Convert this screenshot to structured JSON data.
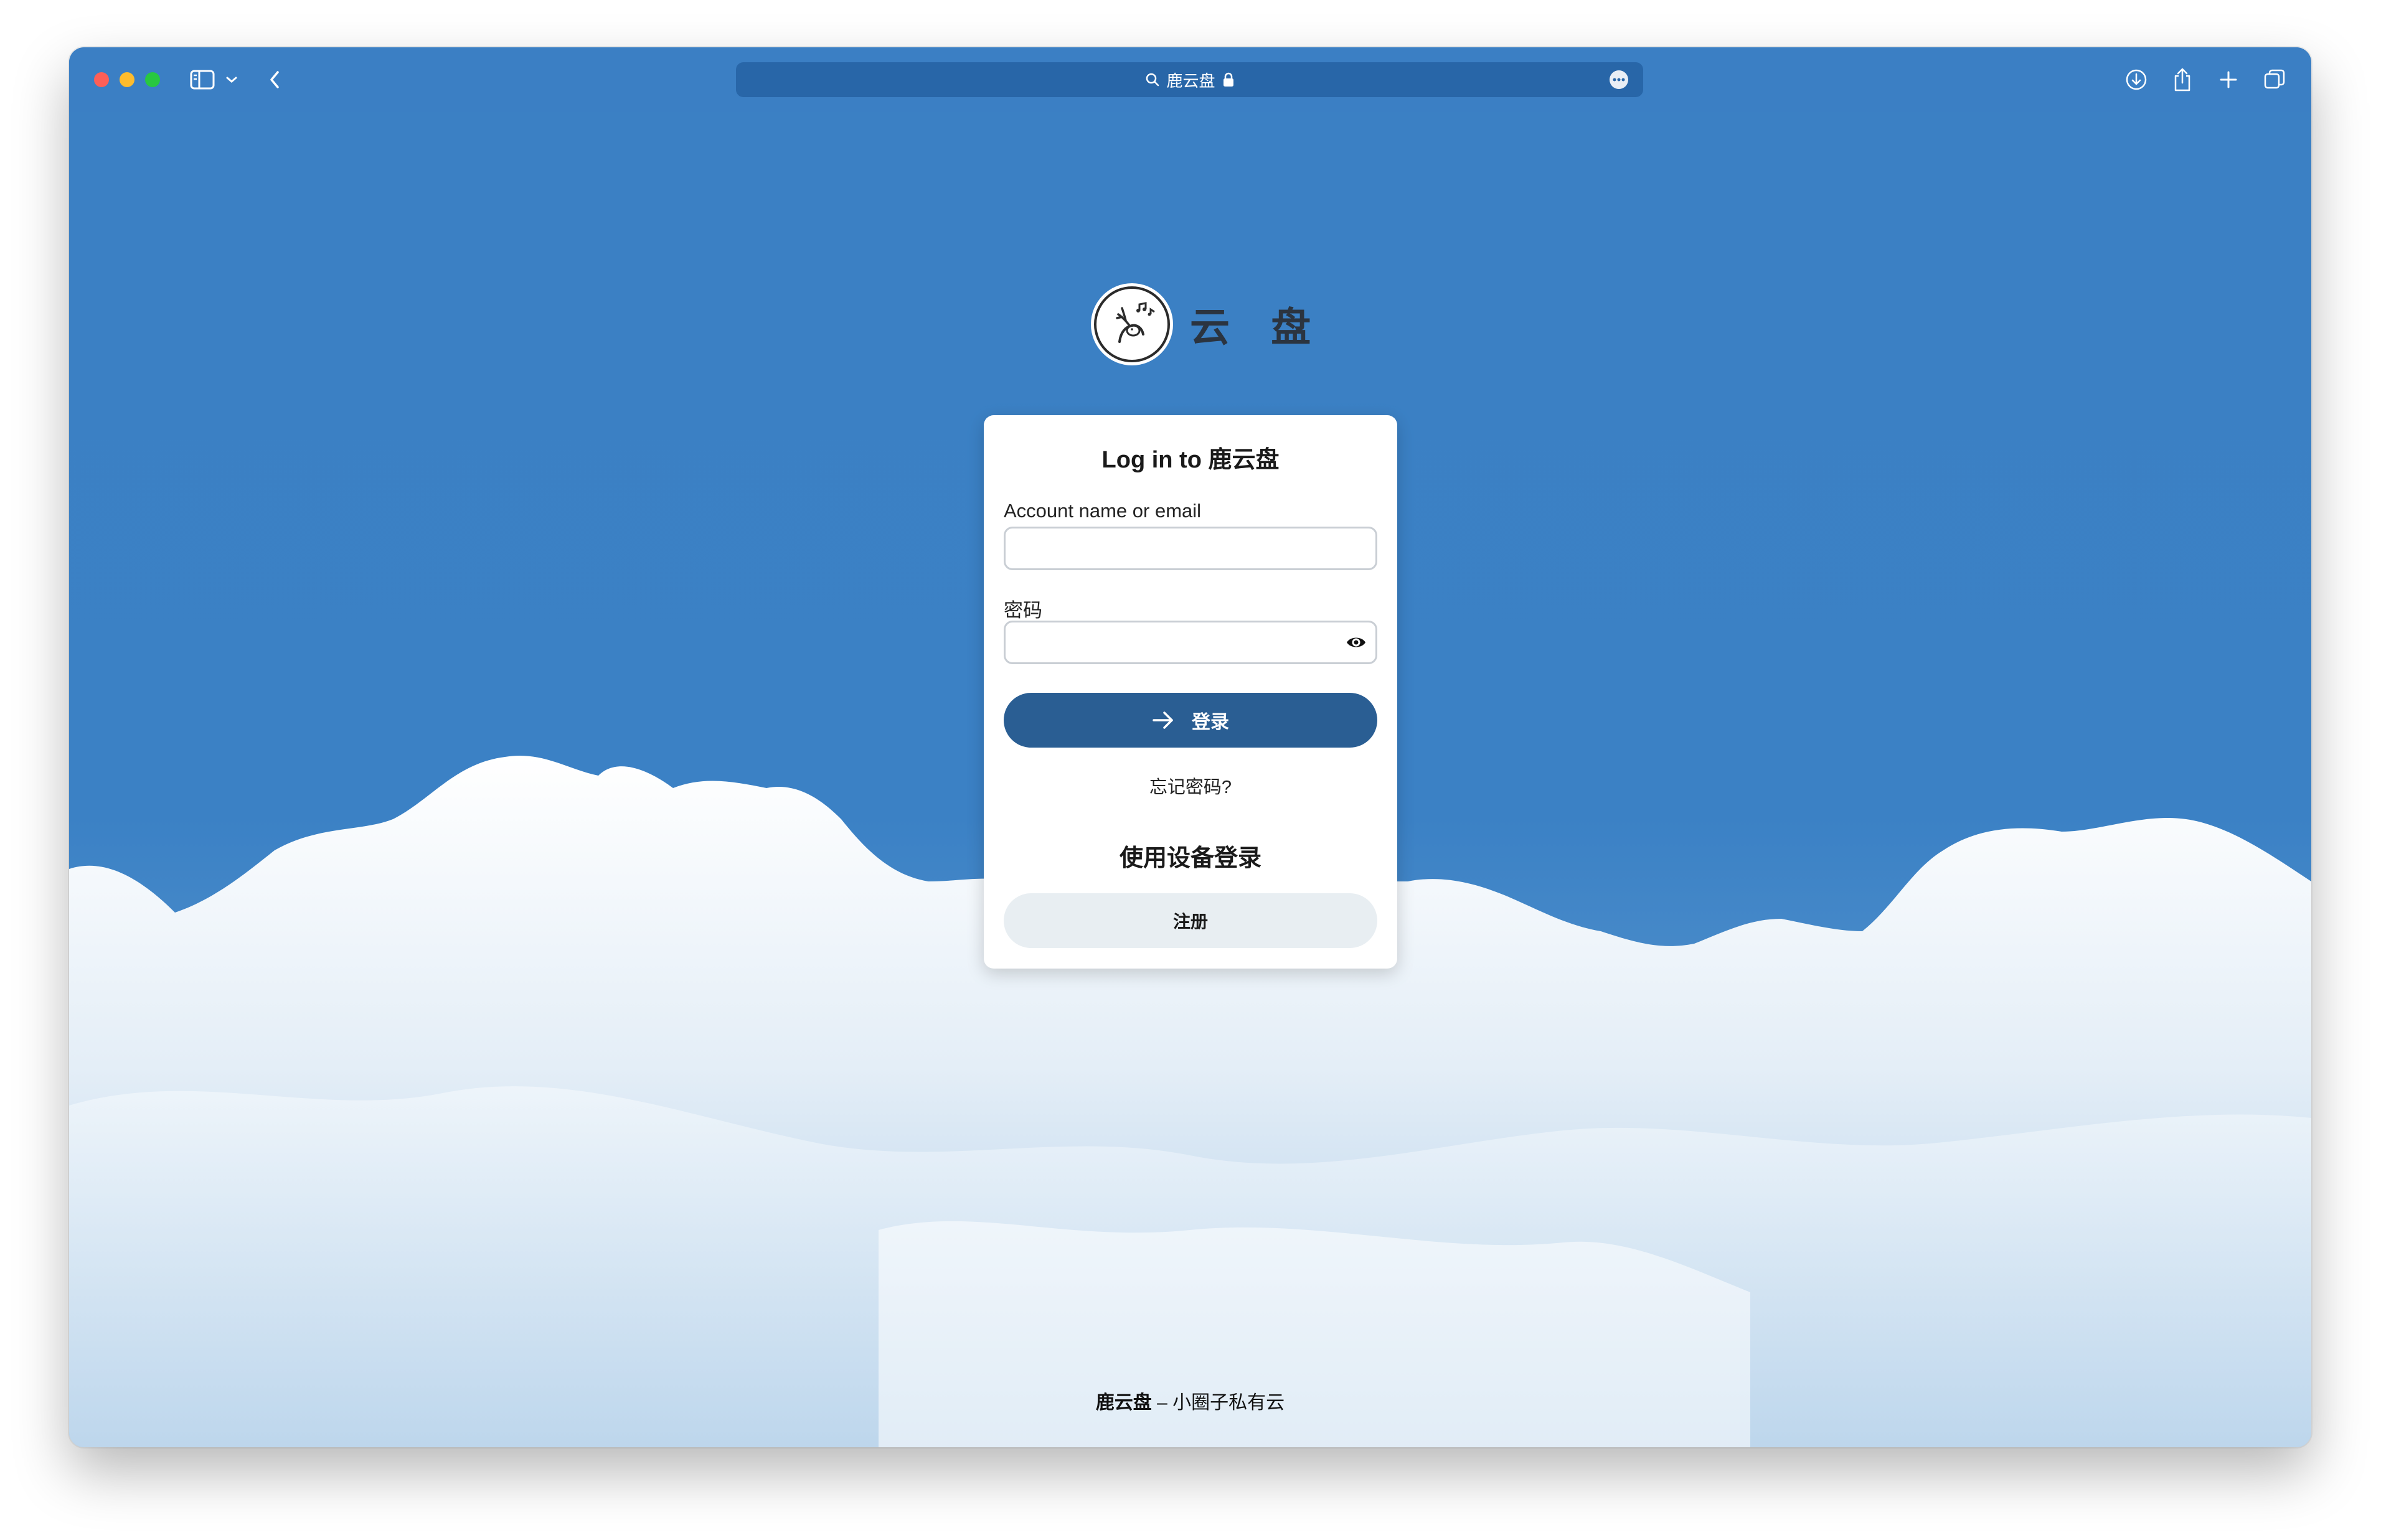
{
  "browser": {
    "address": "鹿云盘"
  },
  "brand": {
    "name": "云 盘"
  },
  "card": {
    "title": "Log in to 鹿云盘",
    "account_label": "Account name or email",
    "account_value": "",
    "password_label": "密码",
    "password_value": "",
    "login_label": "登录",
    "forgot_label": "忘记密码?",
    "device_login_label": "使用设备登录",
    "register_label": "注册"
  },
  "footer": {
    "name": "鹿云盘",
    "separator": " – ",
    "tagline": "小圈子私有云"
  },
  "colors": {
    "sky": "#3b80c4",
    "primary_button": "#2a5e93",
    "secondary_button": "#e8eef2"
  }
}
